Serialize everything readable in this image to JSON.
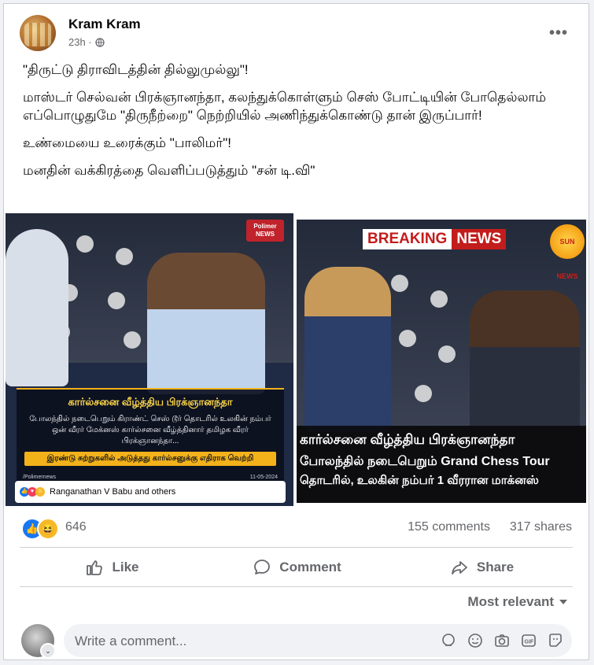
{
  "post": {
    "author": "Kram Kram",
    "time": "23h ·",
    "more_label": "•••",
    "paragraphs": [
      "\"திருட்டு திராவிடத்தின் தில்லுமுல்லு\"!",
      "மாஸ்டர் செல்வன் பிரக்ஞானந்தா, கலந்துக்கொள்ளும் செஸ் போட்டியின் போதெல்லாம் எப்பொழுதுமே \"திருநீற்றை\" நெற்றியில் அணிந்துக்கொண்டு தான் இருப்பார்!",
      "உண்மையை உரைக்கும் \"பாலிமர்\"!",
      "மனதின் வக்கிரத்தை வெளிப்படுத்தும் \"சன் டி.வி\""
    ]
  },
  "image1": {
    "channel": "Polimer NEWS",
    "headline": "கார்ல்சனை வீழ்த்திய பிரக்ஞானந்தா",
    "body": "போலந்தில் நடைபெறும் கிராண்ட் செஸ் டூர் தொடரில் உலகின் நம்பர் ஒன் வீரர் மேக்னஸ் கார்ல்சனை வீழ்த்தினார் தமிழக வீரர் பிரக்ஞானந்தா...",
    "strap": "இரண்டு சுற்றுகளில் அடுத்தது கார்ல்சனுக்கு எதிராக வெற்றி",
    "footer_left": "/Polimernews",
    "footer_date": "11-05-2024",
    "reactions_text": "Ranganathan V Babu and others"
  },
  "image2": {
    "breaking": "BREAKING",
    "news": "NEWS",
    "channel": "SUN NEWS",
    "line1": "கார்ல்சனை வீழ்த்திய பிரக்ஞானந்தா",
    "line2": "போலந்தில் நடைபெறும் Grand Chess Tour",
    "line3": "தொடரில், உலகின் நம்பர் 1 வீரரான மாக்னஸ்"
  },
  "stats": {
    "reaction_count": "646",
    "comments": "155 comments",
    "shares": "317 shares"
  },
  "actions": {
    "like": "Like",
    "comment": "Comment",
    "share": "Share"
  },
  "sort_label": "Most relevant",
  "composer": {
    "placeholder": "Write a comment..."
  },
  "colors": {
    "like_blue": "#1877f2",
    "haha_yellow": "#f7b928",
    "breaking_red": "#c31c1c",
    "polimer_gold": "#f3b21a"
  }
}
